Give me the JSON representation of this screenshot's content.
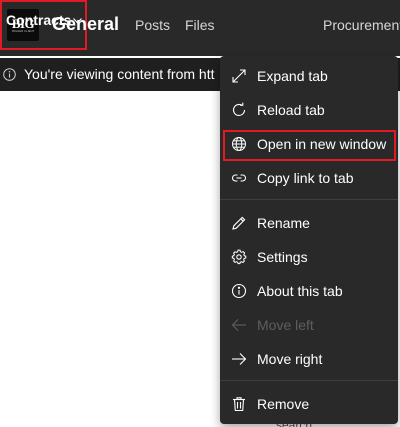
{
  "header": {
    "logo": {
      "main": "BIG",
      "sub": "BIGGER CLIENT"
    },
    "title": "General",
    "tabs": [
      {
        "label": "Posts"
      },
      {
        "label": "Files"
      },
      {
        "label": "Contracts"
      },
      {
        "label": "Procurement"
      }
    ]
  },
  "banner": {
    "text": "You're viewing content from htt"
  },
  "menu": {
    "items": [
      {
        "label": "Expand tab",
        "icon": "expand-icon",
        "enabled": true
      },
      {
        "label": "Reload tab",
        "icon": "reload-icon",
        "enabled": true
      },
      {
        "label": "Open in new window",
        "icon": "globe-icon",
        "enabled": true,
        "highlighted": true
      },
      {
        "label": "Copy link to tab",
        "icon": "link-icon",
        "enabled": true
      },
      {
        "label": "Rename",
        "icon": "pencil-icon",
        "enabled": true
      },
      {
        "label": "Settings",
        "icon": "gear-icon",
        "enabled": true
      },
      {
        "label": "About this tab",
        "icon": "info-icon",
        "enabled": true
      },
      {
        "label": "Move left",
        "icon": "arrow-left-icon",
        "enabled": false
      },
      {
        "label": "Move right",
        "icon": "arrow-right-icon",
        "enabled": true
      },
      {
        "label": "Remove",
        "icon": "trash-icon",
        "enabled": true
      }
    ]
  },
  "content": {
    "bottom_text": "search"
  },
  "colors": {
    "header_bg": "#292929",
    "menu_bg": "#292929",
    "highlight_border": "#e01b24",
    "disabled_text": "#5e5e5e"
  }
}
